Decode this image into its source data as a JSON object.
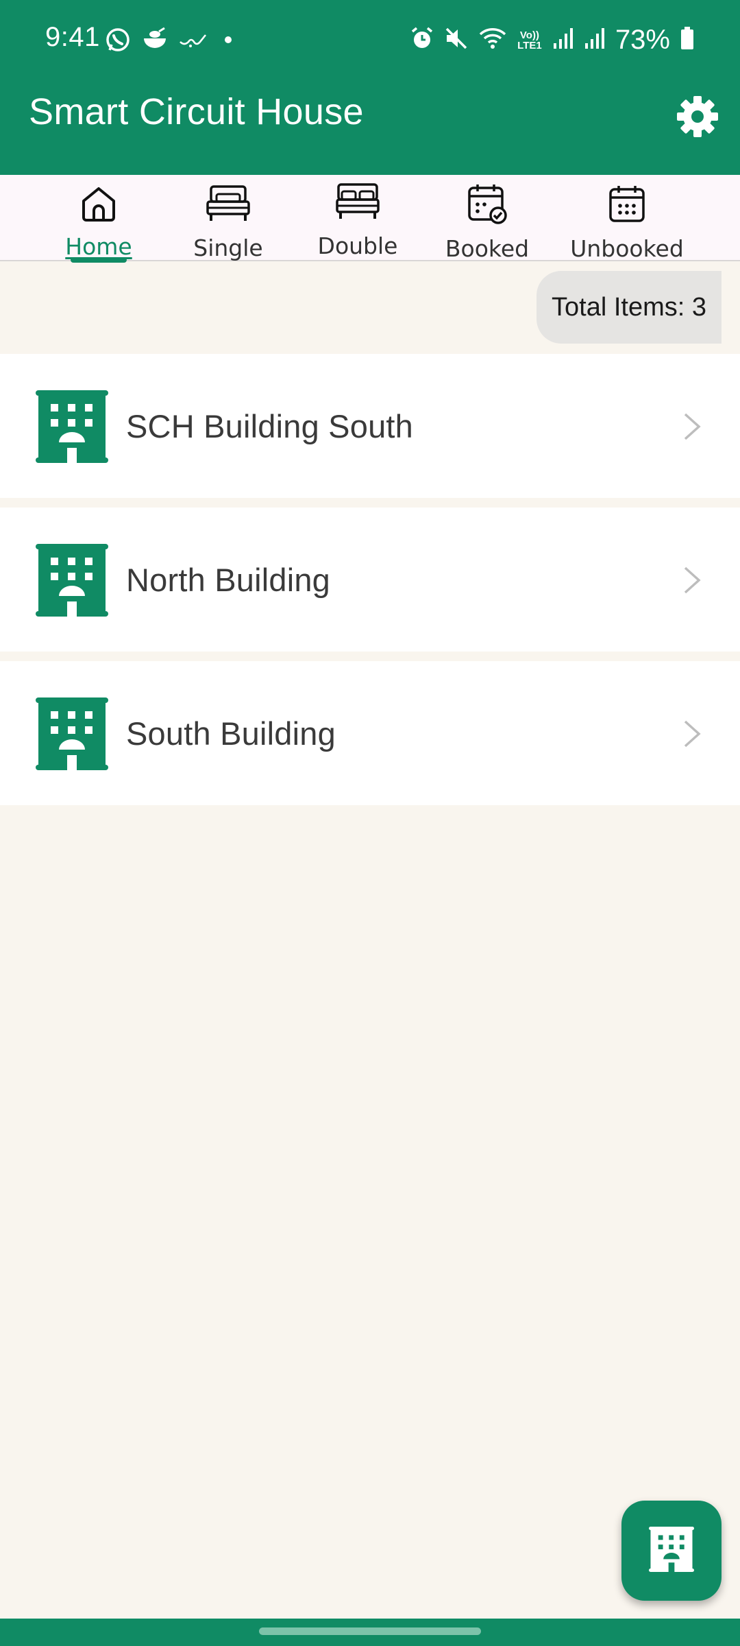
{
  "status_bar": {
    "time": "9:41",
    "battery": "73%",
    "icons_left": [
      "whatsapp-icon",
      "bowl-icon",
      "arabic-app-icon",
      "dot-icon"
    ],
    "icons_right": [
      "alarm-icon",
      "mute-icon",
      "wifi-icon",
      "volte-icon",
      "signal-icon",
      "signal-icon",
      "battery-icon"
    ],
    "volte_label": "Vo)) LTE1"
  },
  "app_bar": {
    "title": "Smart Circuit House",
    "settings_icon": "gear-icon"
  },
  "tabs": [
    {
      "label": "Home",
      "icon": "home-icon",
      "active": true
    },
    {
      "label": "Single",
      "icon": "single-bed-icon",
      "active": false
    },
    {
      "label": "Double",
      "icon": "double-bed-icon",
      "active": false
    },
    {
      "label": "Booked",
      "icon": "calendar-check-icon",
      "active": false
    },
    {
      "label": "Unbooked",
      "icon": "calendar-icon",
      "active": false
    }
  ],
  "summary": {
    "total_label": "Total Items: 3"
  },
  "buildings": [
    {
      "name": "SCH Building South",
      "icon": "building-icon"
    },
    {
      "name": "North Building",
      "icon": "building-icon"
    },
    {
      "name": "South Building",
      "icon": "building-icon"
    }
  ],
  "fab": {
    "icon": "building-icon"
  },
  "colors": {
    "primary": "#108b64",
    "background": "#f9f5ee",
    "tab_bar": "#fdf7fb",
    "chip": "#e5e4e2"
  }
}
